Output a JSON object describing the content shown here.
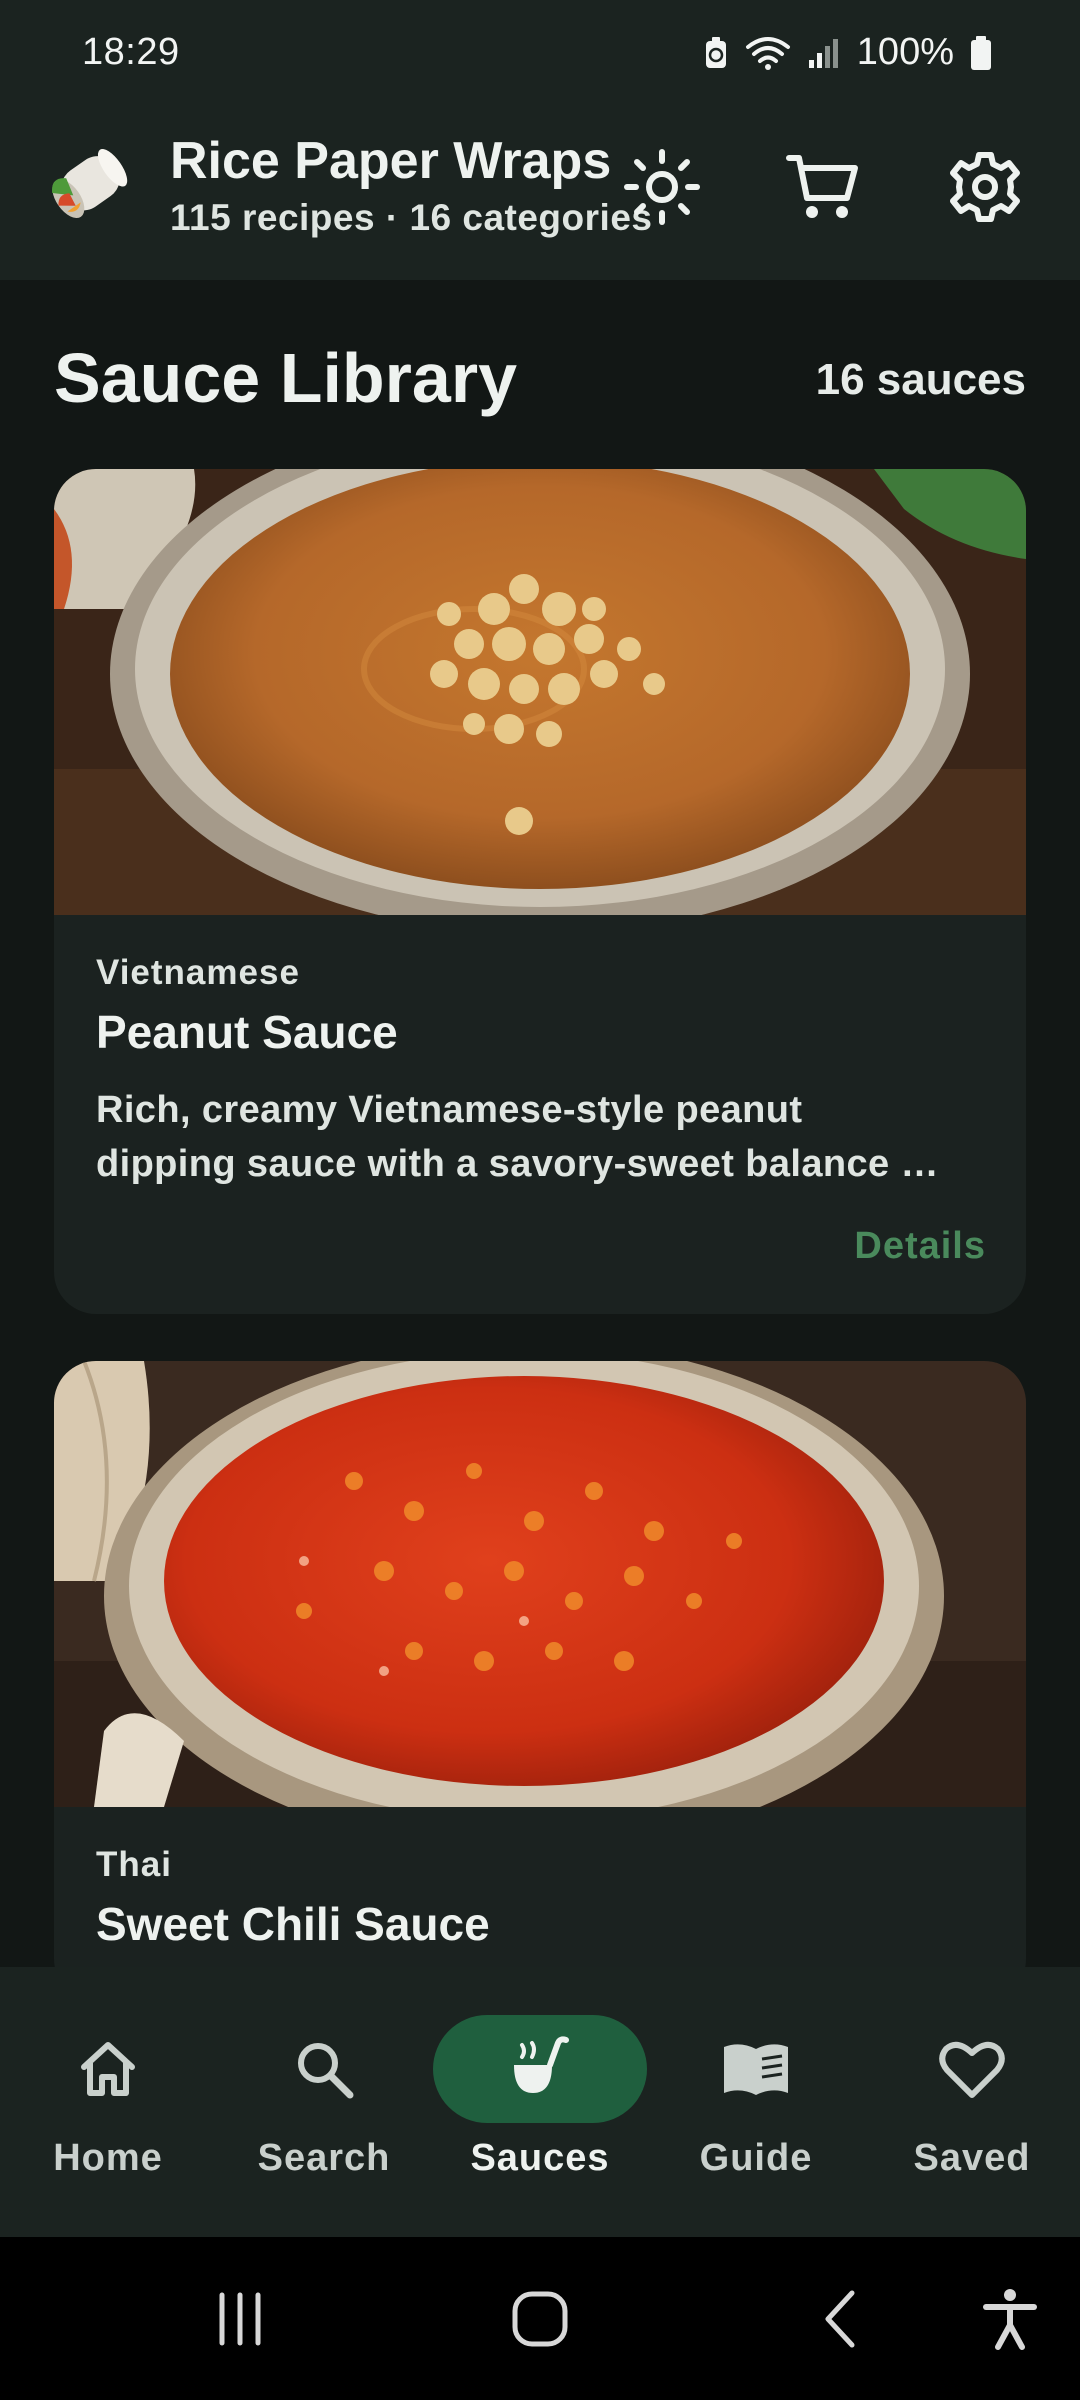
{
  "status_bar": {
    "time": "18:29",
    "battery": "100%"
  },
  "app_bar": {
    "title": "Rice Paper Wraps",
    "subtitle": "115 recipes · 16 categories"
  },
  "header": {
    "title": "Sauce Library",
    "count": "16 sauces"
  },
  "cards": [
    {
      "category": "Vietnamese",
      "name": "Peanut Sauce",
      "description_line1": "Rich, creamy Vietnamese-style peanut",
      "description_line2": "dipping sauce with a savory-sweet balance …",
      "details_label": "Details"
    },
    {
      "category": "Thai",
      "name": "Sweet Chili Sauce"
    }
  ],
  "bottom_nav": [
    {
      "label": "Home",
      "icon": "home-icon"
    },
    {
      "label": "Search",
      "icon": "search-icon"
    },
    {
      "label": "Sauces",
      "icon": "ladle-icon",
      "active": true
    },
    {
      "label": "Guide",
      "icon": "book-icon"
    },
    {
      "label": "Saved",
      "icon": "heart-icon"
    }
  ],
  "colors": {
    "background": "#121715",
    "surface": "#1b2320",
    "accent": "#1f5f3e",
    "link": "#4a8a5c"
  }
}
